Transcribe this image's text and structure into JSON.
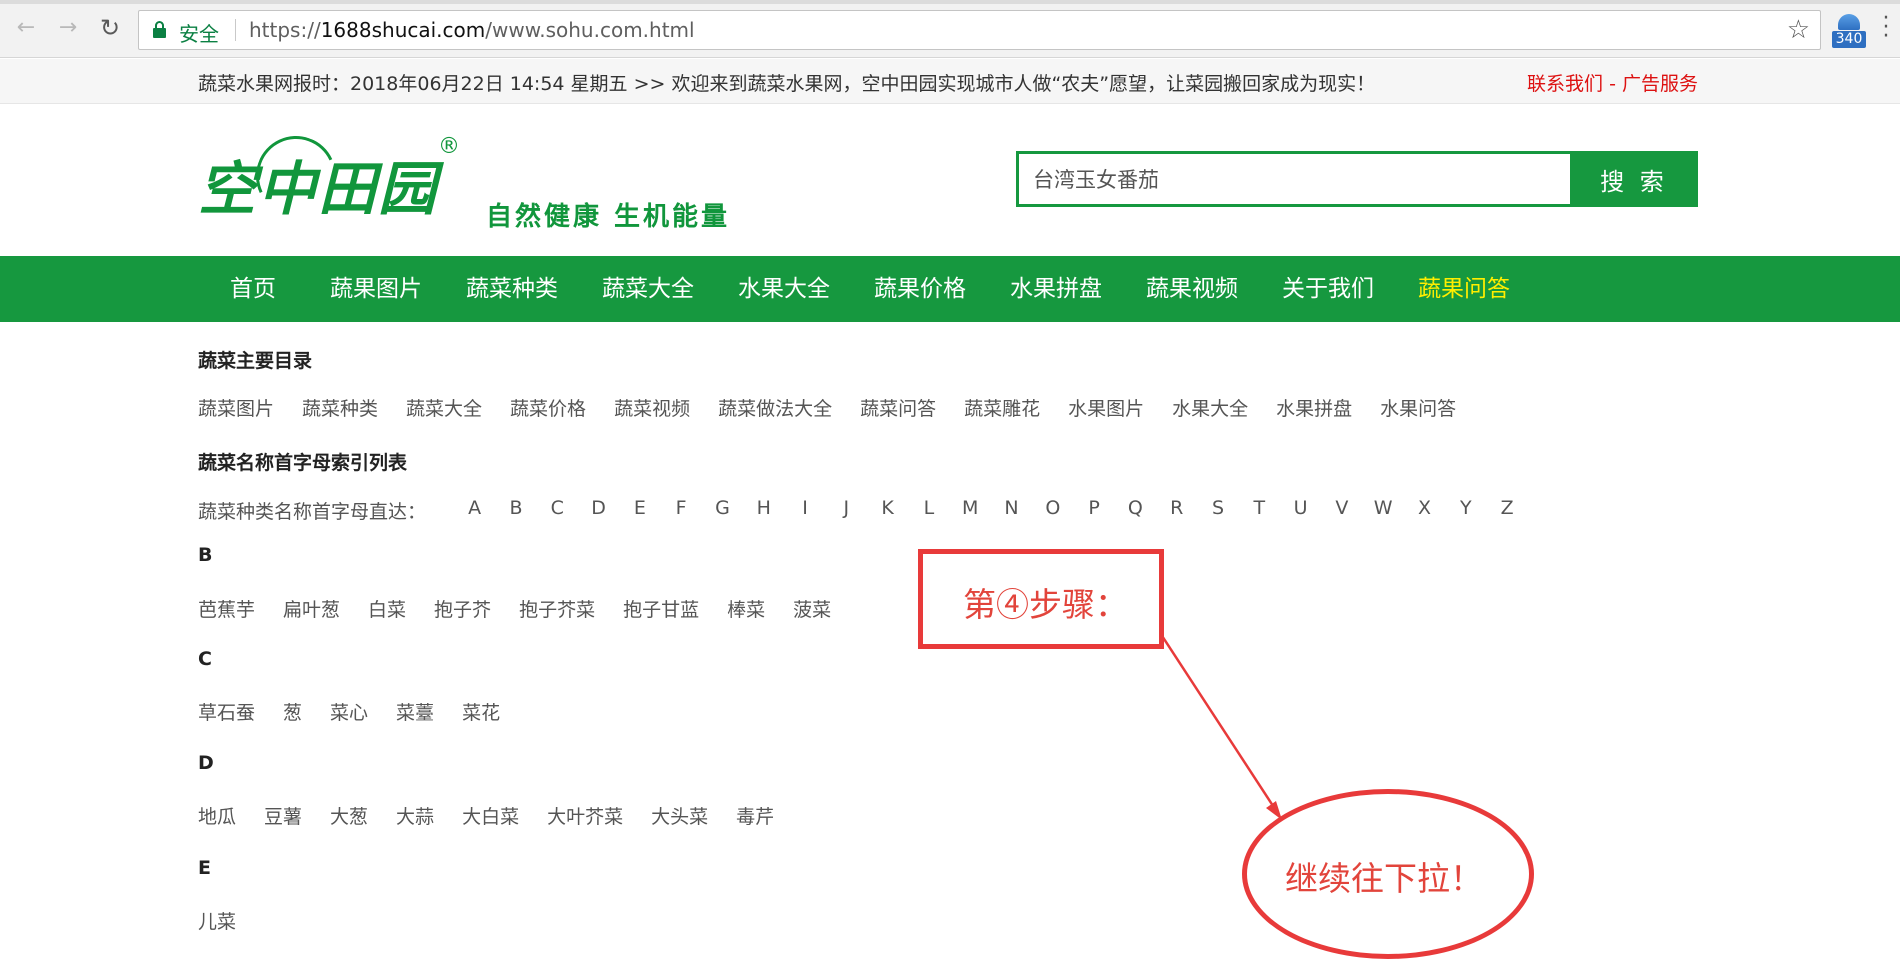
{
  "browser": {
    "secure_label": "安全",
    "url_scheme": "https://",
    "url_host": "1688shucai.com",
    "url_path": "/www.sohu.com.html",
    "ext_badge": "340"
  },
  "topbar": {
    "notice": "蔬菜水果网报时：2018年06月22日 14:54 星期五 >> 欢迎来到蔬菜水果网，空中田园实现城市人做“农夫”愿望，让菜园搬回家成为现实！",
    "contact": "联系我们",
    "link_sep": " - ",
    "ads": "广告服务"
  },
  "logo": {
    "name": "空中田园",
    "reg": "®",
    "slogan": "自然健康 生机能量"
  },
  "search": {
    "value": "台湾玉女番茄",
    "button": "搜 索"
  },
  "nav": [
    {
      "label": "首页",
      "active": false
    },
    {
      "label": "蔬果图片",
      "active": false
    },
    {
      "label": "蔬菜种类",
      "active": false
    },
    {
      "label": "蔬菜大全",
      "active": false
    },
    {
      "label": "水果大全",
      "active": false
    },
    {
      "label": "蔬果价格",
      "active": false
    },
    {
      "label": "水果拼盘",
      "active": false
    },
    {
      "label": "蔬果视频",
      "active": false
    },
    {
      "label": "关于我们",
      "active": false
    },
    {
      "label": "蔬果问答",
      "active": true
    }
  ],
  "main_dir": {
    "title": "蔬菜主要目录",
    "links": [
      "蔬菜图片",
      "蔬菜种类",
      "蔬菜大全",
      "蔬菜价格",
      "蔬菜视频",
      "蔬菜做法大全",
      "蔬菜问答",
      "蔬菜雕花",
      "水果图片",
      "水果大全",
      "水果拼盘",
      "水果问答"
    ]
  },
  "index": {
    "title": "蔬菜名称首字母索引列表",
    "prefix": "蔬菜种类名称首字母直达：",
    "letters": [
      "A",
      "B",
      "C",
      "D",
      "E",
      "F",
      "G",
      "H",
      "I",
      "J",
      "K",
      "L",
      "M",
      "N",
      "O",
      "P",
      "Q",
      "R",
      "S",
      "T",
      "U",
      "V",
      "W",
      "X",
      "Y",
      "Z"
    ]
  },
  "groups": [
    {
      "letter": "B",
      "items": [
        "芭蕉芋",
        "扁叶葱",
        "白菜",
        "抱子芥",
        "抱子芥菜",
        "抱子甘蓝",
        "棒菜",
        "菠菜"
      ]
    },
    {
      "letter": "C",
      "items": [
        "草石蚕",
        "葱",
        "菜心",
        "菜薹",
        "菜花"
      ]
    },
    {
      "letter": "D",
      "items": [
        "地瓜",
        "豆薯",
        "大葱",
        "大蒜",
        "大白菜",
        "大叶芥菜",
        "大头菜",
        "毒芹"
      ]
    },
    {
      "letter": "E",
      "items": [
        "儿菜"
      ]
    }
  ],
  "annotations": {
    "step": "第④步骤：",
    "hint": "继续往下拉！",
    "color": "#e83a3a"
  }
}
